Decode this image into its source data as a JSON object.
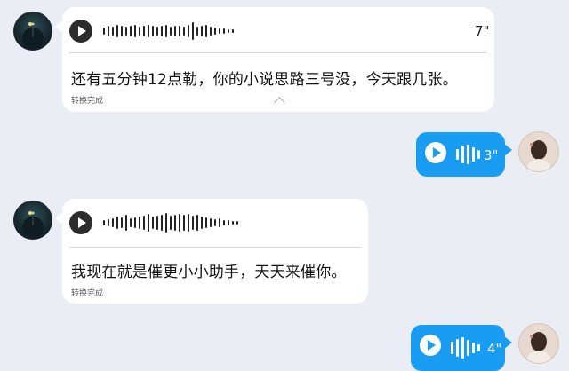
{
  "chat": {
    "messages": [
      {
        "side": "left",
        "duration": "7\"",
        "transcript": "还有五分钟12点勒，你的小说思路三号没，今天跟几张。",
        "status": "转换完成"
      },
      {
        "side": "right",
        "duration": "3\""
      },
      {
        "side": "left",
        "duration": "",
        "transcript": "我现在就是催更小小助手，天天来催你。",
        "status": "转换完成"
      },
      {
        "side": "right",
        "duration": "4\""
      }
    ]
  },
  "colors": {
    "background": "#ebedf5",
    "sent_bubble": "#199df2",
    "received_bubble": "#ffffff"
  },
  "icons": {
    "play": "play-icon",
    "collapse": "chevron-up-icon"
  }
}
